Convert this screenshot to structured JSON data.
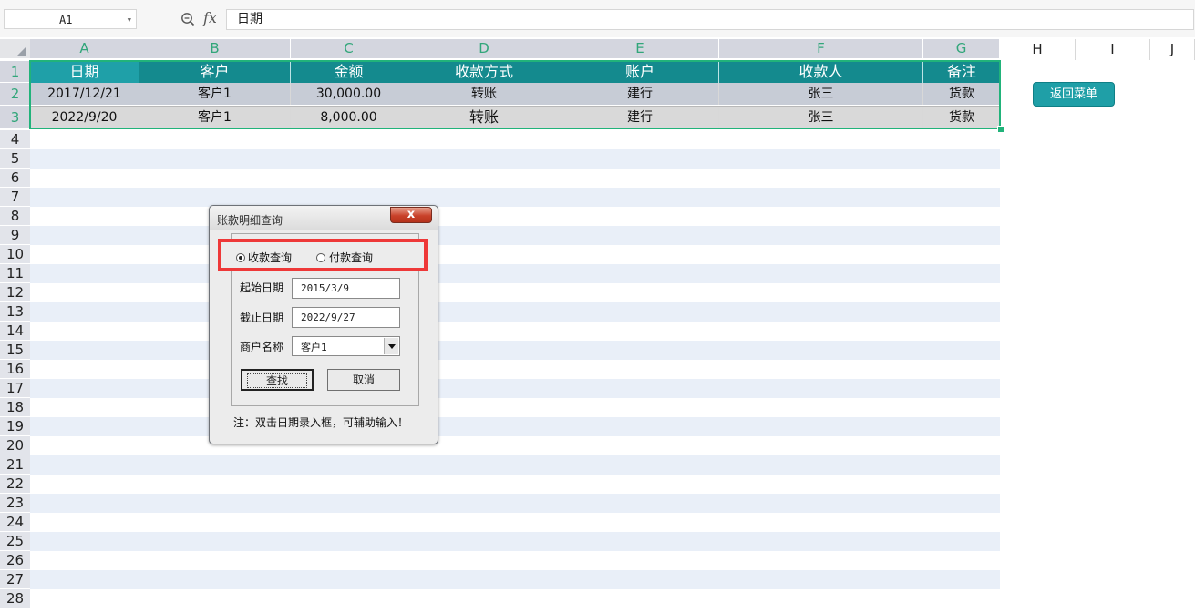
{
  "formula_bar": {
    "cell_ref": "A1",
    "formula": "日期",
    "fx_label": "fx",
    "icons": [
      "zoom-icon",
      "chevron-down-icon"
    ]
  },
  "columns": [
    "A",
    "B",
    "C",
    "D",
    "E",
    "F",
    "G",
    "H",
    "I",
    "J"
  ],
  "rows": [
    "1",
    "2",
    "3",
    "4",
    "5",
    "6",
    "7",
    "8",
    "9",
    "10",
    "11",
    "12",
    "13",
    "14",
    "15",
    "16",
    "17",
    "18",
    "19",
    "20",
    "21",
    "22",
    "23",
    "24",
    "25",
    "26",
    "27",
    "28"
  ],
  "table": {
    "headers": [
      "日期",
      "客户",
      "金额",
      "收款方式",
      "账户",
      "收款人",
      "备注"
    ],
    "data": [
      [
        "2017/12/21",
        "客户1",
        "30,000.00",
        "转账",
        "建行",
        "张三",
        "货款"
      ],
      [
        "2022/9/20",
        "客户1",
        "8,000.00",
        "转账",
        "建行",
        "张三",
        "货款"
      ]
    ]
  },
  "menu_button": {
    "label": "返回菜单"
  },
  "dialog": {
    "title": "账款明细查询",
    "close_symbol": "x",
    "radio_options": [
      {
        "label": "收款查询",
        "selected": true
      },
      {
        "label": "付款查询",
        "selected": false
      }
    ],
    "start_date_label": "起始日期",
    "start_date_value": "2015/3/9",
    "end_date_label": "截止日期",
    "end_date_value": "2022/9/27",
    "merchant_label": "商户名称",
    "merchant_value": "客户1",
    "find_button": "查找",
    "cancel_button": "取消",
    "note": "注：双击日期录入框，可辅助输入！"
  },
  "colors": {
    "header_bg": "#148a8e",
    "header_first_bg": "#1fa0a8",
    "selection_border": "#21b37a",
    "band_blue": "#e9eff8",
    "highlight_red": "#ee3838",
    "menu_button_bg": "#1f9fa7"
  }
}
